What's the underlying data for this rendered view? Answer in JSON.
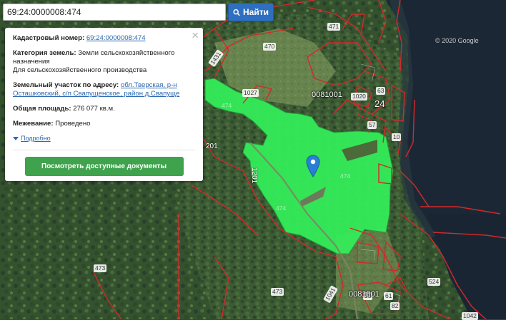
{
  "search": {
    "value": "69:24:0000008:474",
    "button_label": "Найти"
  },
  "info_panel": {
    "cadastral_label": "Кадастровый номер:",
    "cadastral_number": "69:24:0000008:474",
    "category_label": "Категория земель:",
    "category_value": "Земли сельскохозяйственного назначения",
    "category_purpose": "Для сельскохозяйственного производства",
    "address_label": "Земельный участок по адресу:",
    "address_value": "обл.Тверская, р-н Осташковский, с/п Свапущенское, район д.Свапуще",
    "area_label": "Общая площадь:",
    "area_value": "276 077 кв.м.",
    "survey_label": "Межевание:",
    "survey_value": "Проведено",
    "details_label": "Подробно",
    "docs_button": "Посмотреть доступные документы"
  },
  "map": {
    "copyright": "© 2020 Google",
    "parcel_labels": [
      "474",
      "470",
      "471",
      "1431",
      "1027",
      "1020",
      "24",
      "201",
      "1201",
      "473",
      "473",
      "1041",
      "524",
      "1042",
      "10",
      "57",
      "63",
      "61",
      "98",
      "82"
    ],
    "block_labels": [
      "0081001",
      "0081001",
      "24"
    ],
    "colors": {
      "highlight": "#33ee55",
      "boundary": "#d22a2a",
      "water": "#1d2a3a",
      "forest": "#3b5a33",
      "pin": "#2a7fd4"
    }
  }
}
